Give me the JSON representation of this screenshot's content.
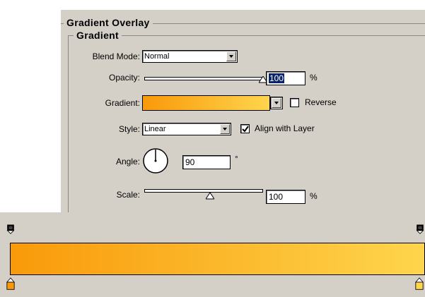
{
  "panel": {
    "title": "Gradient Overlay",
    "group_title": "Gradient"
  },
  "fields": {
    "blend_mode": {
      "label": "Blend Mode:",
      "value": "Normal"
    },
    "opacity": {
      "label": "Opacity:",
      "value": "100",
      "unit": "%",
      "level": 1.0
    },
    "gradient": {
      "label": "Gradient:"
    },
    "reverse": {
      "label": "Reverse",
      "checked": false
    },
    "style": {
      "label": "Style:",
      "value": "Linear"
    },
    "align_with_layer": {
      "label": "Align with Layer",
      "checked": true
    },
    "angle": {
      "label": "Angle:",
      "value": "90",
      "unit": "°"
    },
    "scale": {
      "label": "Scale:",
      "value": "100",
      "unit": "%",
      "level": 0.5
    }
  },
  "colors": {
    "gradient_start": "#f99a0a",
    "gradient_end": "#fed54c",
    "panel_bg": "#d4d0c8",
    "selection": "#0a246a"
  },
  "icons": {
    "opacity_stop_left": "opacity-stop-icon",
    "opacity_stop_right": "opacity-stop-icon",
    "color_stop_left": "color-stop-icon",
    "color_stop_right": "color-stop-icon"
  }
}
